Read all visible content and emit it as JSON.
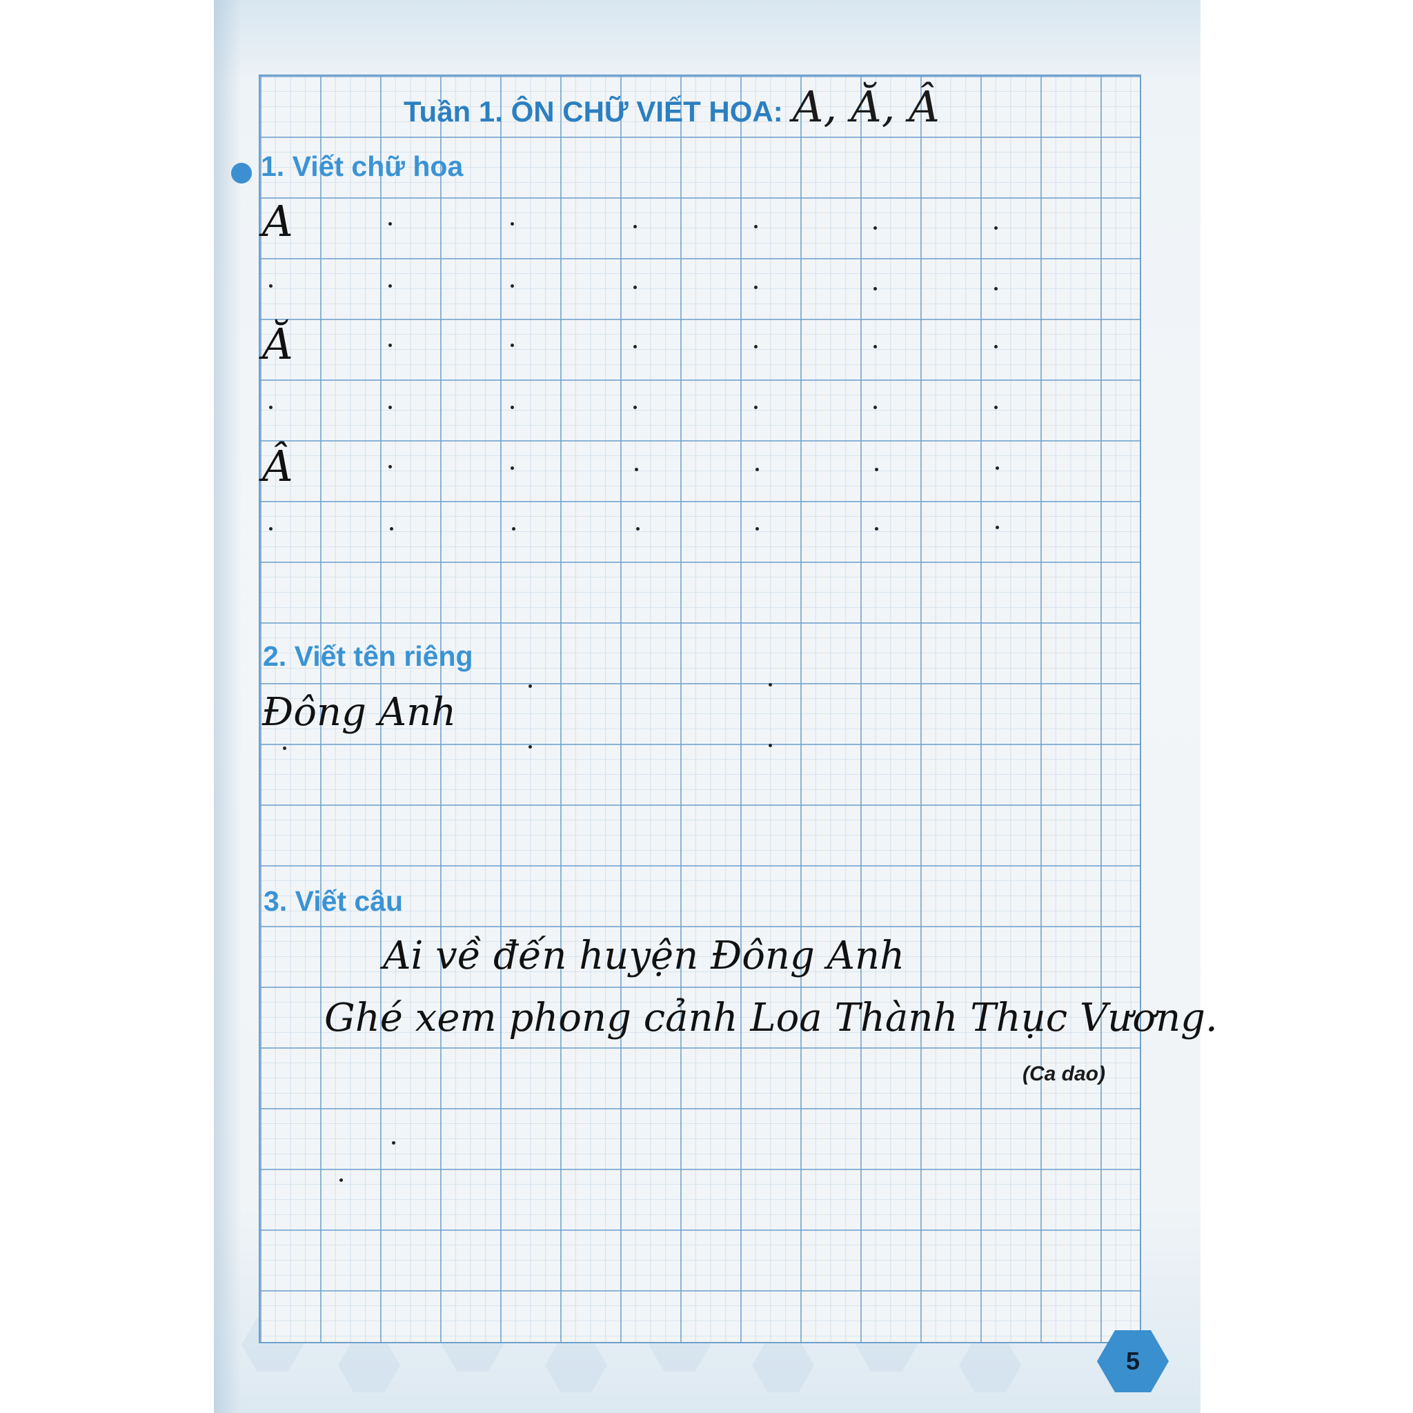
{
  "title": {
    "prefix": "Tuần 1. ÔN CHỮ VIẾT HOA:",
    "letters": "A, Ă, Â"
  },
  "section1": {
    "heading": "1. Viết chữ hoa",
    "letters": [
      "A",
      "Ă",
      "Â"
    ]
  },
  "section2": {
    "heading": "2. Viết tên riêng",
    "name": "Đông Anh"
  },
  "section3": {
    "heading": "3. Viết câu",
    "line1": "Ai về đến huyện Đông Anh",
    "line2": "Ghé xem phong cảnh Loa Thành Thục Vương.",
    "source": "(Ca dao)"
  },
  "page_number": "5"
}
